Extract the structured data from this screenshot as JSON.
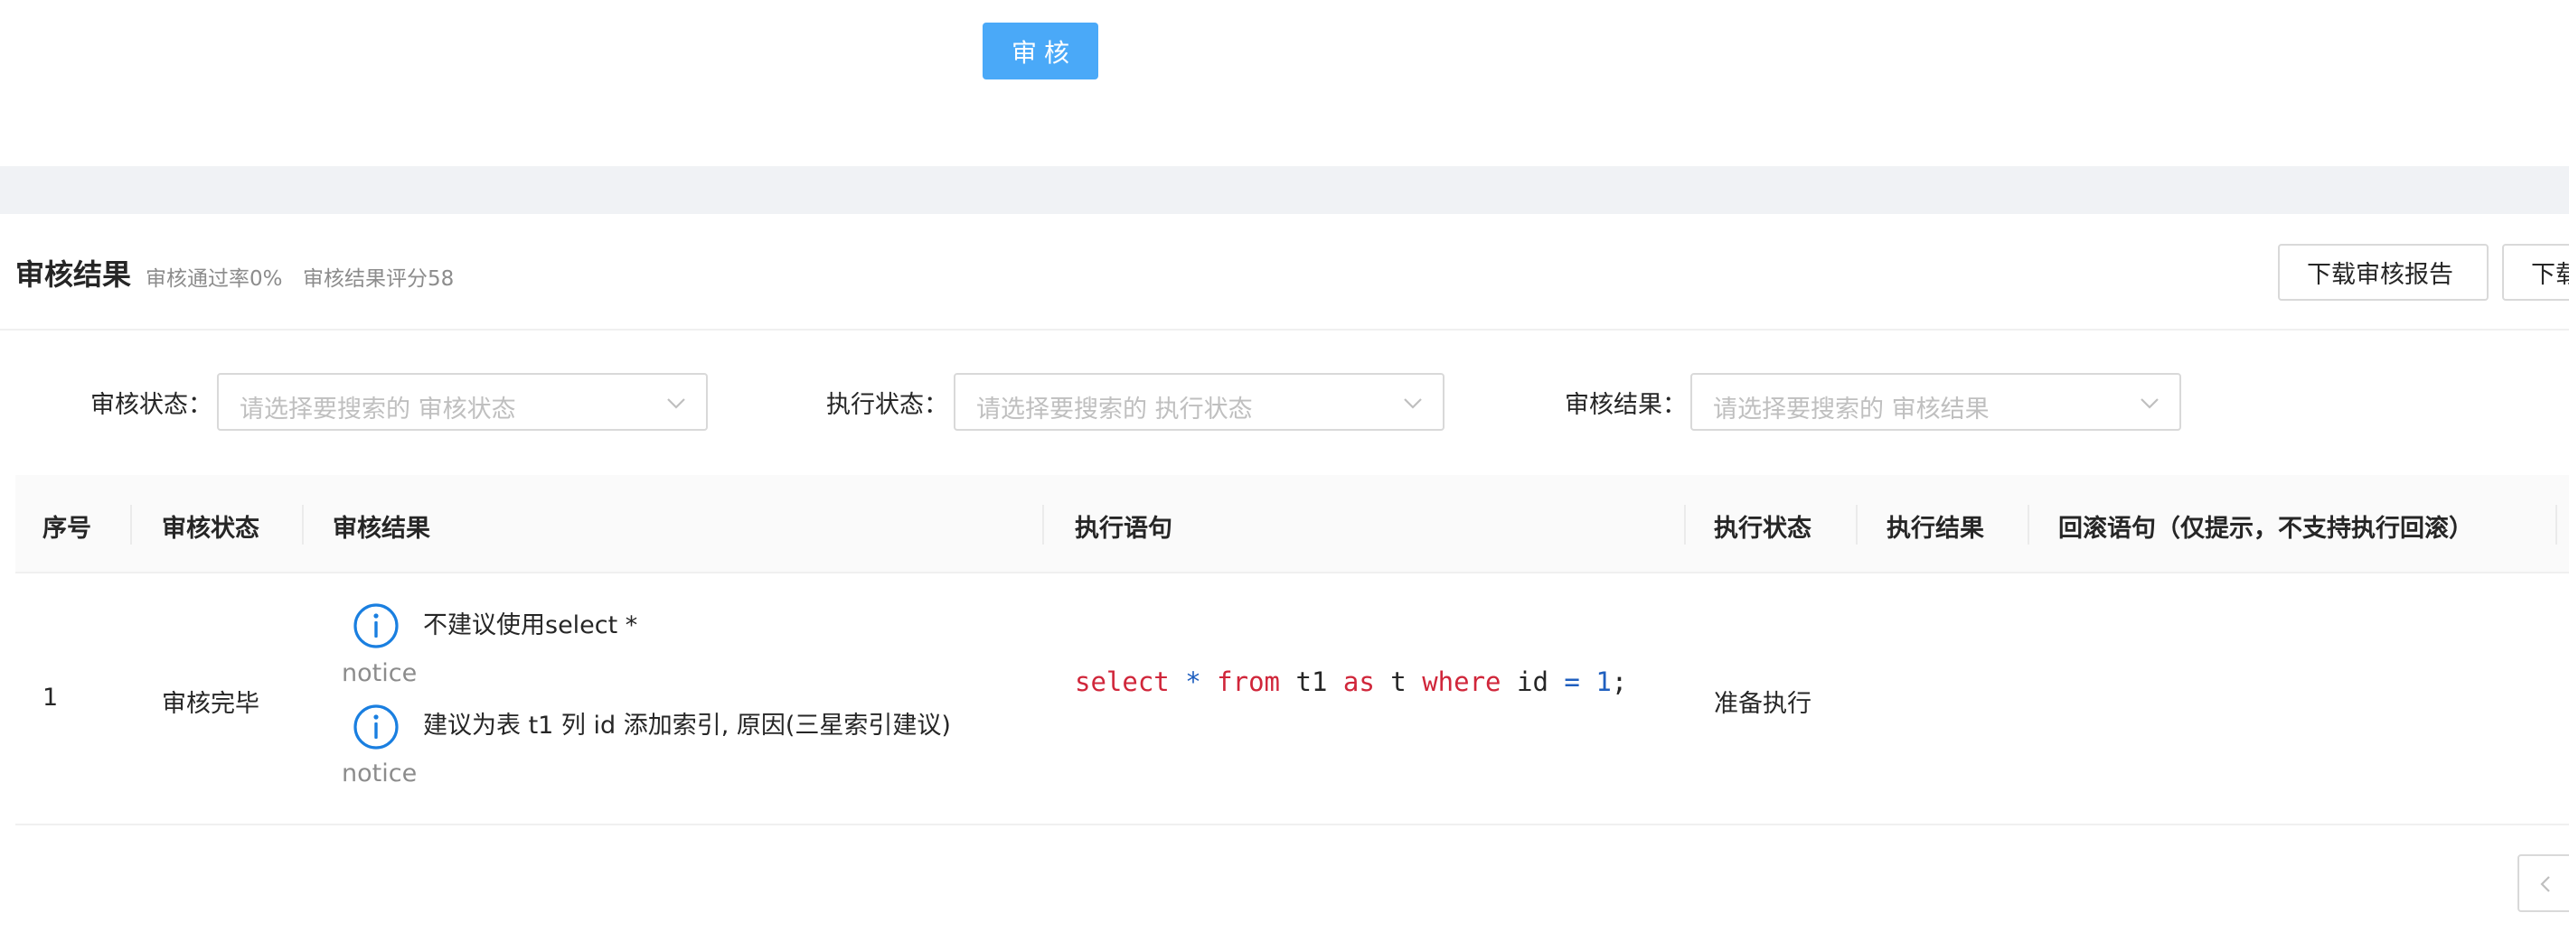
{
  "top": {
    "audit_button": "审核"
  },
  "results": {
    "title": "审核结果",
    "pass_rate": "审核通过率0%",
    "score": "审核结果评分58",
    "download_report": "下载审核报告",
    "download_more": "下载"
  },
  "filters": [
    {
      "label": "审核状态：",
      "placeholder": "请选择要搜索的 审核状态"
    },
    {
      "label": "执行状态：",
      "placeholder": "请选择要搜索的 执行状态"
    },
    {
      "label": "审核结果：",
      "placeholder": "请选择要搜索的 审核结果"
    }
  ],
  "table": {
    "columns": [
      "序号",
      "审核状态",
      "审核结果",
      "执行语句",
      "执行状态",
      "执行结果",
      "回滚语句（仅提示，不支持执行回滚）"
    ],
    "rows": [
      {
        "index": "1",
        "audit_status": "审核完毕",
        "results": [
          {
            "message": "不建议使用select *",
            "level": "notice",
            "icon": "info-circle-icon"
          },
          {
            "message": "建议为表 t1 列 id 添加索引, 原因(三星索引建议)",
            "level": "notice",
            "icon": "info-circle-icon"
          }
        ],
        "sql": {
          "select": "select",
          "star": "*",
          "from": "from",
          "table": "t1",
          "as": "as",
          "alias": "t",
          "where": "where",
          "column": "id",
          "eq": "=",
          "value": "1",
          "end": ";"
        },
        "exec_status": "准备执行",
        "exec_result": "",
        "rollback": ""
      }
    ]
  },
  "pagination": {
    "prev_icon": "chevron-left-icon"
  },
  "colors": {
    "primary": "#4aa9f8",
    "info_icon": "#1a7fe0",
    "sql_keyword": "#d0263a",
    "sql_operator": "#1f5fbf",
    "band": "#f0f2f5"
  }
}
